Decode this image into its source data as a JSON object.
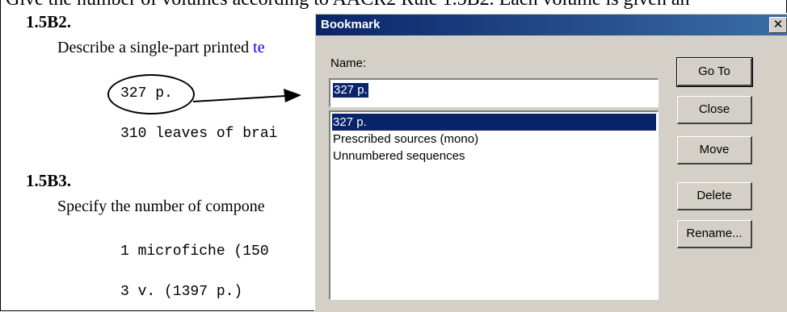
{
  "document": {
    "cut_top_text": "Give the number of volumes according to AACR2 Rule 1.5B2. Each volume is given an",
    "heading_1": "1.5B2.",
    "para_1": "Describe a single-part printed ",
    "para_1_link": "te",
    "example_1": "327 p.",
    "example_2": "310 leaves of brai",
    "heading_2": "1.5B3.",
    "para_2": "Specify the number of compone",
    "example_3": "1 microfiche (150",
    "example_4": "3 v. (1397 p.)"
  },
  "dialog": {
    "title": "Bookmark",
    "close_glyph": "✕",
    "name_label": "Name:",
    "name_value": "327 p.",
    "list_items": [
      "327 p.",
      "Prescribed sources (mono)",
      "Unnumbered sequences"
    ],
    "selected_index": 0,
    "buttons": {
      "goto": "Go To",
      "close": "Close",
      "move": "Move",
      "delete": "Delete",
      "rename": "Rename..."
    }
  },
  "colors": {
    "title_bar": "#0a246a",
    "selection": "#0a246a",
    "dialog_face": "#d4d0c8",
    "link": "#0000ee"
  }
}
